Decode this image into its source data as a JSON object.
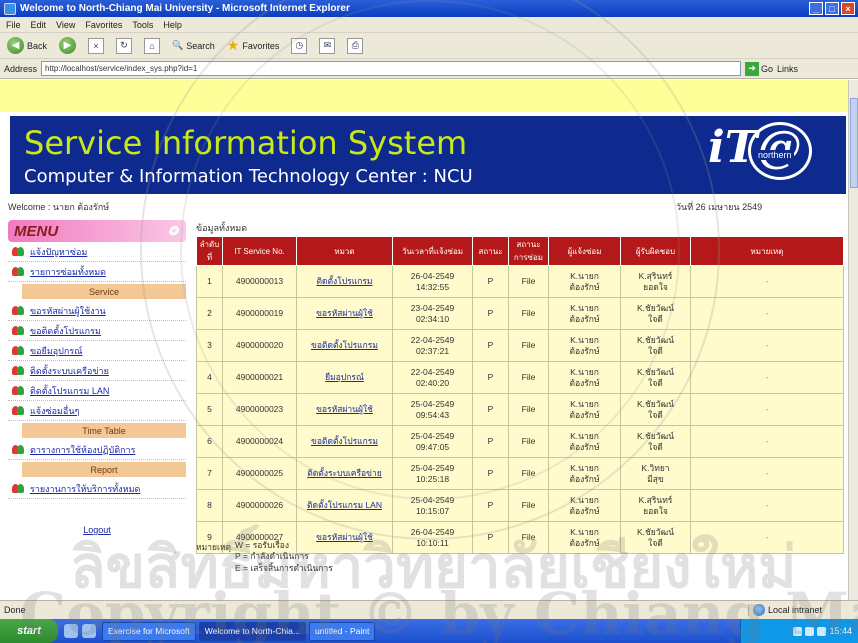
{
  "window": {
    "title": "Welcome to North-Chiang Mai University - Microsoft Internet Explorer",
    "menu": [
      "File",
      "Edit",
      "View",
      "Favorites",
      "Tools",
      "Help"
    ],
    "toolbar": {
      "back": "Back",
      "search": "Search",
      "favorites": "Favorites"
    },
    "address_label": "Address",
    "address_url": "http://localhost/service/index_sys.php?id=1",
    "go_label": "Go",
    "links_label": "Links"
  },
  "page": {
    "banner": {
      "title": "Service Information System",
      "subtitle": "Computer & Information Technology Center : NCU",
      "logo_text": "iT@",
      "logo_sub": "northern"
    },
    "welcome": "Welcome : นายก ต้องรักษ์",
    "date": "วันที่ 26 เมษายน 2549",
    "menu": {
      "header": "MENU",
      "items_top": [
        "แจ้งปัญหาซ่อม",
        "รายการซ่อมทั้งหมด"
      ],
      "section1": "Service",
      "items_service": [
        "ขอรหัสผ่านผู้ใช้งาน",
        "ขอติดตั้งโปรแกรม",
        "ขอยืมอุปกรณ์",
        "ติดตั้งระบบเครือข่าย",
        "ติดตั้งโปรแกรม LAN",
        "แจ้งซ่อมอื่นๆ"
      ],
      "section2": "Time Table",
      "items_time": [
        "ตารางการใช้ห้องปฏิบัติการ"
      ],
      "section3": "Report",
      "items_report": [
        "รายงานการให้บริการทั้งหมด"
      ],
      "logout": "Logout"
    },
    "table_caption": "ข้อมูลทั้งหมด",
    "columns": [
      "ลำดับที่",
      "IT Service No.",
      "หมวด",
      "วันเวลาที่แจ้งซ่อม",
      "สถานะ",
      "สถานะการซ่อม",
      "ผู้แจ้งซ่อม",
      "ผู้รับผิดชอบ",
      "หมายเหตุ"
    ],
    "rows": [
      {
        "no": "1",
        "id": "4900000013",
        "cat": "ติดตั้งโปรแกรม",
        "date": "26-04-2549",
        "time": "14:32:55",
        "s1": "P",
        "s2": "File",
        "req": "K.นายก",
        "req2": "ต้องรักษ์",
        "resp": "K.สุรินทร์",
        "resp2": "ยอดใจ",
        "note": "-"
      },
      {
        "no": "2",
        "id": "4900000019",
        "cat": "ขอรหัสผ่านผู้ใช้",
        "date": "23-04-2549",
        "time": "02:34:10",
        "s1": "P",
        "s2": "File",
        "req": "K.นายก",
        "req2": "ต้องรักษ์",
        "resp": "K.ชัยวัฒน์",
        "resp2": "ใจดี",
        "note": "-"
      },
      {
        "no": "3",
        "id": "4900000020",
        "cat": "ขอติดตั้งโปรแกรม",
        "date": "22-04-2549",
        "time": "02:37:21",
        "s1": "P",
        "s2": "File",
        "req": "K.นายก",
        "req2": "ต้องรักษ์",
        "resp": "K.ชัยวัฒน์",
        "resp2": "ใจดี",
        "note": "-"
      },
      {
        "no": "4",
        "id": "4900000021",
        "cat": "ยืมอุปกรณ์",
        "date": "22-04-2549",
        "time": "02:40:20",
        "s1": "P",
        "s2": "File",
        "req": "K.นายก",
        "req2": "ต้องรักษ์",
        "resp": "K.ชัยวัฒน์",
        "resp2": "ใจดี",
        "note": "-"
      },
      {
        "no": "5",
        "id": "4900000023",
        "cat": "ขอรหัสผ่านผู้ใช้",
        "date": "25-04-2549",
        "time": "09:54:43",
        "s1": "P",
        "s2": "File",
        "req": "K.นายก",
        "req2": "ต้องรักษ์",
        "resp": "K.ชัยวัฒน์",
        "resp2": "ใจดี",
        "note": "-"
      },
      {
        "no": "6",
        "id": "4900000024",
        "cat": "ขอติดตั้งโปรแกรม",
        "date": "25-04-2549",
        "time": "09:47:05",
        "s1": "P",
        "s2": "File",
        "req": "K.นายก",
        "req2": "ต้องรักษ์",
        "resp": "K.ชัยวัฒน์",
        "resp2": "ใจดี",
        "note": "-"
      },
      {
        "no": "7",
        "id": "4900000025",
        "cat": "ติดตั้งระบบเครือข่าย",
        "date": "25-04-2549",
        "time": "10:25:18",
        "s1": "P",
        "s2": "File",
        "req": "K.นายก",
        "req2": "ต้องรักษ์",
        "resp": "K.วิทยา",
        "resp2": "มีสุข",
        "note": "-"
      },
      {
        "no": "8",
        "id": "4900000026",
        "cat": "ติดตั้งโปรแกรม LAN",
        "date": "25-04-2549",
        "time": "10:15:07",
        "s1": "P",
        "s2": "File",
        "req": "K.นายก",
        "req2": "ต้องรักษ์",
        "resp": "K.สุรินทร์",
        "resp2": "ยอดใจ",
        "note": "-"
      },
      {
        "no": "9",
        "id": "4900000027",
        "cat": "ขอรหัสผ่านผู้ใช้",
        "date": "26-04-2549",
        "time": "10:10:11",
        "s1": "P",
        "s2": "File",
        "req": "K.นายก",
        "req2": "ต้องรักษ์",
        "resp": "K.ชัยวัฒน์",
        "resp2": "ใจดี",
        "note": "-"
      }
    ],
    "legend_title": "หมายเหตุ",
    "legend": [
      "W = รอรับเรื่อง",
      "P = กำลังดำเนินการ",
      "E = เสร็จสิ้นการดำเนินการ"
    ]
  },
  "statusbar": {
    "status": "Done",
    "zone": "Local intranet"
  },
  "taskbar": {
    "start": "start",
    "tasks": [
      "Exercise for Microsoft",
      "Welcome to North-Chia...",
      "untitled - Paint"
    ],
    "clock": "15:44"
  },
  "watermark": {
    "line1": "ลิขสิทธิ์มหาวิทยาลัยเชียงใหม่",
    "line2": "Copyright © by Chiang Mai University"
  }
}
